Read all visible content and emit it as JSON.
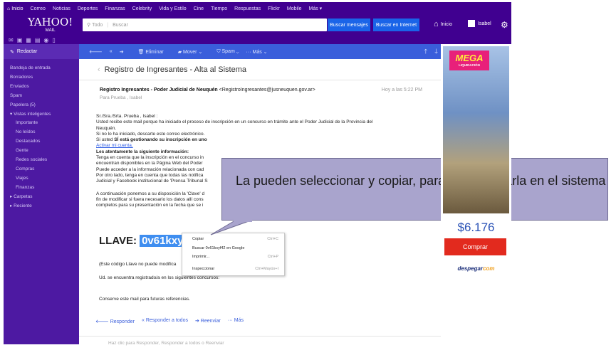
{
  "topnav": {
    "items": [
      "Inicio",
      "Correo",
      "Noticias",
      "Deportes",
      "Finanzas",
      "Celebrity",
      "Vida y Estilo",
      "Cine",
      "Tiempo",
      "Respuestas",
      "Flickr",
      "Mobile",
      "Más ▾"
    ]
  },
  "header": {
    "logo": "YAHOO!",
    "logo_sub": "MAIL",
    "search_scope": "Todo",
    "search_placeholder": "Buscar",
    "btn_search_messages": "Buscar mensajes",
    "btn_search_web": "Buscar en Internet",
    "home_label": "Inicio",
    "user_name": "Isabel"
  },
  "sidebar": {
    "compose": "Redactar",
    "items": [
      "Bandeja de entrada",
      "Borradores",
      "Enviados",
      "Spam",
      "Papelera (5)",
      "Vistas inteligentes",
      "Importante",
      "No leídos",
      "Destacados",
      "Gente",
      "Redes sociales",
      "Compras",
      "Viajes",
      "Finanzas",
      "Carpetas",
      "Reciente"
    ]
  },
  "toolbar": {
    "delete": "Eliminar",
    "move": "Mover",
    "spam": "Spam",
    "more": "Más"
  },
  "email": {
    "subject": "Registro de Ingresantes - Alta al Sistema",
    "from_name": "Registro Ingresantes - Poder Judicial de Neuquén",
    "from_email": "<RegistroIngresantes@jusneuquen.gov.ar>",
    "time": "Hoy a las 5:22 PM",
    "to": "Para Prueba , Isabel",
    "greeting": "Sr./Sra./Srta. Prueba , Isabel :",
    "p1": "Usted recibe este mail porque ha iniciado el proceso de inscripción en un concurso en trámite ante el Poder Judicial de la Provincia del",
    "p1b": "Neuquén.",
    "p2": "Si no lo ha iniciado, descarte este correo electrónico.",
    "p3_pre": "Si usted ",
    "p3_bold": "SÍ está gestionando su inscripción en uno",
    "p4_link": "Activar mi cuenta.",
    "p5_bold": "Les atentamente la siguiente información:",
    "p6": "Tenga en cuenta que la inscripción en el concurso in",
    "p7": "encuentran disponibles en la Página Web del Poder",
    "p8": "Puede acceder a la información relacionada con cad",
    "p9": "Por otro lado, tenga en cuenta que todas las notifica",
    "p10": "Judicial y Facebook institucional de 'Prensa Tribunal S",
    "p11": "A continuación ponemos a su disposición la 'Clave' d",
    "p12": "fin de modificar si fuera necesario los datos allí cons",
    "p13": "completos para su presentación en la fecha que se i",
    "llave_label": "LLAVE:",
    "llave_value": "0v61kxyf42",
    "note1": "(Este código Llave no puede modifica",
    "note2": "Ud. se encuentra registrado/a en los siguientes concursos:",
    "note3": "Conserve este mail para futuras referencias.",
    "reply": "Responder",
    "reply_all": "Responder a todos",
    "forward": "Reenviar",
    "more": "Más",
    "reply_hint": "Haz clic para Responder, Responder a todos o Reenviar"
  },
  "context_menu": {
    "copy": "Copiar",
    "copy_sc": "Ctrl+C",
    "search": "Buscar 0v61kxyf42 en Google",
    "print": "Imprimir...",
    "print_sc": "Ctrl+P",
    "inspect": "Inspeccionar",
    "inspect_sc": "Ctrl+Mayús+I"
  },
  "callout": {
    "text": "La pueden seleccionar y copiar, para luego pegarla en el sistema"
  },
  "ad": {
    "mega": "MEGA",
    "mega_sub": "LIQUIDACIÓN",
    "price": "$6.176",
    "buy": "Comprar",
    "brand": "despegar",
    "brand_com": "com"
  }
}
